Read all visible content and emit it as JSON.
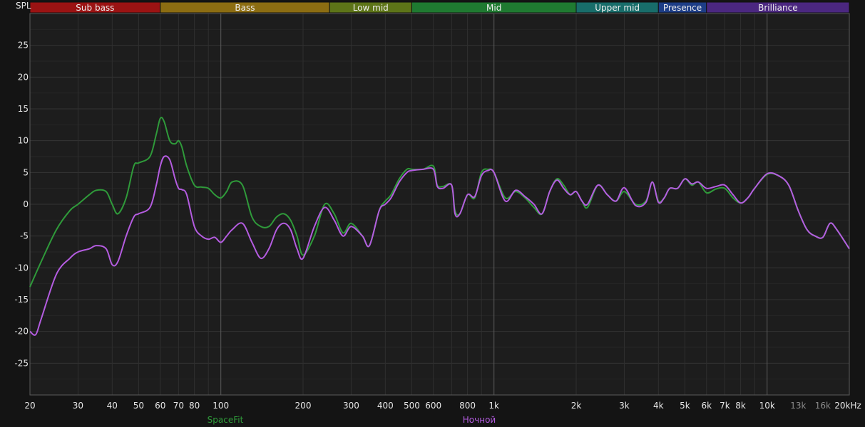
{
  "chart_data": {
    "type": "line",
    "ylabel": "SPL",
    "x_scale": "log",
    "xlim": [
      20,
      20000
    ],
    "ylim": [
      -30,
      30
    ],
    "grid": true,
    "y_ticks": [
      25,
      20,
      15,
      10,
      5,
      0,
      -5,
      -10,
      -15,
      -20,
      -25
    ],
    "x_ticks": [
      {
        "v": 20,
        "label": "20"
      },
      {
        "v": 30,
        "label": "30"
      },
      {
        "v": 40,
        "label": "40"
      },
      {
        "v": 50,
        "label": "50"
      },
      {
        "v": 60,
        "label": "60"
      },
      {
        "v": 70,
        "label": "70"
      },
      {
        "v": 80,
        "label": "80"
      },
      {
        "v": 100,
        "label": "100"
      },
      {
        "v": 200,
        "label": "200"
      },
      {
        "v": 300,
        "label": "300"
      },
      {
        "v": 400,
        "label": "400"
      },
      {
        "v": 500,
        "label": "500"
      },
      {
        "v": 600,
        "label": "600"
      },
      {
        "v": 800,
        "label": "800"
      },
      {
        "v": 1000,
        "label": "1k"
      },
      {
        "v": 2000,
        "label": "2k"
      },
      {
        "v": 3000,
        "label": "3k"
      },
      {
        "v": 4000,
        "label": "4k"
      },
      {
        "v": 5000,
        "label": "5k"
      },
      {
        "v": 6000,
        "label": "6k"
      },
      {
        "v": 7000,
        "label": "7k"
      },
      {
        "v": 8000,
        "label": "8k"
      },
      {
        "v": 10000,
        "label": "10k"
      },
      {
        "v": 13000,
        "label": "13k",
        "dim": true
      },
      {
        "v": 16000,
        "label": "16k",
        "dim": true
      },
      {
        "v": 20000,
        "label": "20kHz"
      }
    ],
    "bands": [
      {
        "label": "Sub bass",
        "from": 20,
        "to": 60,
        "color": "#9b1313"
      },
      {
        "label": "Bass",
        "from": 60,
        "to": 250,
        "color": "#8c6d12"
      },
      {
        "label": "Low mid",
        "from": 250,
        "to": 500,
        "color": "#5d7418"
      },
      {
        "label": "Mid",
        "from": 500,
        "to": 2000,
        "color": "#1f7a31"
      },
      {
        "label": "Upper mid",
        "from": 2000,
        "to": 4000,
        "color": "#186d6a"
      },
      {
        "label": "Presence",
        "from": 4000,
        "to": 6000,
        "color": "#1d3d86"
      },
      {
        "label": "Brilliance",
        "from": 6000,
        "to": 20000,
        "color": "#4b2780"
      }
    ],
    "series": [
      {
        "name": "SpaceFit",
        "color": "#2f9a3a",
        "x": [
          20,
          22,
          25,
          28,
          30,
          33,
          35,
          38,
          40,
          42,
          45,
          48,
          50,
          55,
          58,
          60,
          62,
          65,
          68,
          70,
          72,
          75,
          80,
          85,
          90,
          95,
          100,
          105,
          110,
          120,
          130,
          140,
          150,
          160,
          170,
          180,
          190,
          200,
          220,
          240,
          260,
          280,
          300,
          330,
          350,
          380,
          400,
          420,
          450,
          480,
          500,
          550,
          600,
          620,
          650,
          700,
          720,
          750,
          800,
          850,
          900,
          950,
          1000,
          1100,
          1200,
          1300,
          1400,
          1500,
          1600,
          1700,
          1800,
          1900,
          2000,
          2100,
          2200,
          2400,
          2600,
          2800,
          3000,
          3300,
          3600,
          3800,
          4000,
          4200,
          4400,
          4700,
          5000,
          5300,
          5600,
          6000,
          6500,
          7000,
          7500,
          8000,
          8500,
          9000,
          10000,
          11000,
          12000,
          13000,
          14000,
          15000,
          16000,
          17000,
          18000,
          20000
        ],
        "y": [
          -13,
          -9,
          -4,
          -1,
          0,
          1.5,
          2.2,
          2,
          0,
          -1.5,
          1,
          6,
          6.5,
          7.5,
          11,
          13.5,
          13,
          10,
          9.5,
          10,
          9,
          6,
          3,
          2.7,
          2.5,
          1.5,
          1,
          2,
          3.5,
          3,
          -2,
          -3.5,
          -3.5,
          -2,
          -1.5,
          -2.5,
          -5,
          -8,
          -5,
          0,
          -1.5,
          -4.5,
          -3,
          -5,
          -6.5,
          -1,
          0.5,
          1.5,
          4,
          5.5,
          5.5,
          5.5,
          6,
          3,
          2.8,
          3,
          -1,
          -1.5,
          1.5,
          1,
          5,
          5.5,
          5,
          1,
          2,
          1,
          -0.5,
          -1.5,
          2,
          4,
          3,
          1.5,
          2,
          0.5,
          -0.5,
          3,
          1.5,
          0.5,
          2,
          0,
          0.5,
          3.5,
          0.5,
          1,
          2.5,
          2.5,
          4,
          3,
          3.5,
          1.8,
          2.4,
          2.5,
          1,
          0.2,
          1,
          2.5,
          4.7,
          4.5,
          3,
          -1,
          -4,
          -5,
          -5.2,
          -3,
          -4,
          -7
        ]
      },
      {
        "name": "Ночной",
        "color": "#b45ce0",
        "x": [
          20,
          21,
          22,
          25,
          28,
          30,
          33,
          35,
          38,
          40,
          42,
          45,
          48,
          50,
          55,
          58,
          60,
          62,
          65,
          68,
          70,
          72,
          75,
          80,
          85,
          90,
          95,
          100,
          105,
          110,
          120,
          130,
          140,
          150,
          160,
          170,
          180,
          190,
          200,
          220,
          240,
          260,
          280,
          300,
          330,
          350,
          380,
          400,
          420,
          450,
          480,
          500,
          550,
          600,
          620,
          650,
          700,
          720,
          750,
          800,
          850,
          900,
          950,
          1000,
          1100,
          1200,
          1300,
          1400,
          1500,
          1600,
          1700,
          1800,
          1900,
          2000,
          2100,
          2200,
          2400,
          2600,
          2800,
          3000,
          3300,
          3600,
          3800,
          4000,
          4200,
          4400,
          4700,
          5000,
          5300,
          5600,
          6000,
          6500,
          7000,
          7500,
          8000,
          8500,
          9000,
          10000,
          11000,
          12000,
          13000,
          14000,
          15000,
          16000,
          17000,
          18000,
          20000
        ],
        "y": [
          -20,
          -20.5,
          -18,
          -11,
          -8.5,
          -7.5,
          -7,
          -6.5,
          -7,
          -9.5,
          -9,
          -5,
          -2,
          -1.5,
          -0.5,
          3,
          6,
          7.5,
          7,
          4,
          2.5,
          2.3,
          1.5,
          -3.5,
          -5,
          -5.5,
          -5.2,
          -6,
          -5,
          -4,
          -3,
          -6,
          -8.5,
          -7,
          -4,
          -3,
          -4,
          -7,
          -8.5,
          -3.5,
          -0.5,
          -2.5,
          -5,
          -3.5,
          -5,
          -6.5,
          -1,
          0,
          1,
          3.5,
          5,
          5.3,
          5.5,
          5.5,
          2.8,
          2.5,
          3,
          -1.5,
          -1.5,
          1.5,
          1.2,
          4.5,
          5.3,
          5,
          0.5,
          2.2,
          1.2,
          0,
          -1.5,
          2,
          3.8,
          2.5,
          1.5,
          2,
          0.5,
          0,
          3,
          1.5,
          0.5,
          2.6,
          -0.2,
          0.3,
          3.5,
          0.3,
          1,
          2.5,
          2.5,
          4,
          3.2,
          3.5,
          2.5,
          2.8,
          3,
          1.5,
          0.2,
          1,
          2.5,
          4.8,
          4.5,
          3,
          -1,
          -4,
          -5,
          -5.2,
          -3,
          -4,
          -7
        ]
      }
    ]
  }
}
